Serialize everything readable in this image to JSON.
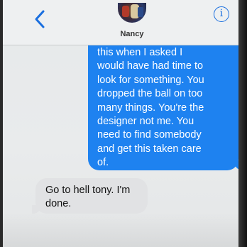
{
  "header": {
    "contact_name": "Nancy",
    "info_glyph": "i",
    "back_icon": "chevron-left-icon",
    "info_icon": "info-icon"
  },
  "messages": {
    "sent": {
      "text": "this when I asked I\nwould have had time to\nlook for something. You\ndropped the ball on too\nmany things. You're the\ndesigner not me. You\nneed to find somebody\nand get this taken care\nof."
    },
    "received": {
      "text": "Go to hell tony. I'm\ndone."
    }
  },
  "colors": {
    "accent": "#1a6fdf",
    "sent_bubble": "#1e82f0",
    "received_bubble": "#e1e2e4"
  }
}
